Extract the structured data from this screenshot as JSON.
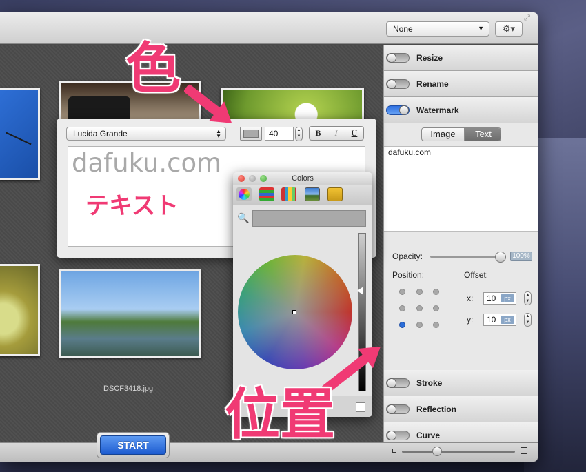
{
  "toolbar": {
    "preset_value": "None",
    "gear_symbol": "⚙▾",
    "resize_symbol": "⤢"
  },
  "canvas": {
    "caption": "DSCF3418.jpg"
  },
  "start_label": "START",
  "sidebar": {
    "sections": [
      {
        "label": "Resize",
        "enabled": false
      },
      {
        "label": "Rename",
        "enabled": false
      },
      {
        "label": "Watermark",
        "enabled": true
      },
      {
        "label": "Stroke",
        "enabled": false
      },
      {
        "label": "Reflection",
        "enabled": false
      },
      {
        "label": "Curve",
        "enabled": false
      }
    ],
    "watermark": {
      "mode_image": "Image",
      "mode_text": "Text",
      "selected_mode": "Text",
      "text_value": "dafuku.com",
      "opacity_label": "Opacity:",
      "opacity_value": "100%",
      "opacity_fraction": 1.0,
      "position_label": "Position:",
      "position_selected": "bottom-left",
      "offset_label": "Offset:",
      "offset_x_label": "x:",
      "offset_x_value": "10",
      "offset_y_label": "y:",
      "offset_y_value": "10",
      "offset_unit": "px"
    }
  },
  "font_panel": {
    "font_name": "Lucida Grande",
    "color_swatch": "#a9a9a9",
    "font_size": "40",
    "bold_label": "B",
    "italic_label": "I",
    "underline_label": "U",
    "preview_text": "dafuku.com"
  },
  "colors_panel": {
    "title": "Colors"
  },
  "annotations": {
    "color_callout": "色",
    "text_callout": "テキスト",
    "position_callout": "位置",
    "color": "#f03a74"
  }
}
